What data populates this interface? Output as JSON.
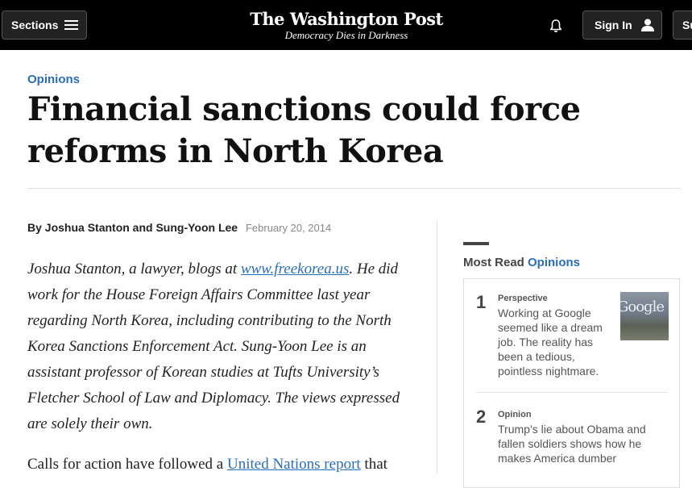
{
  "header": {
    "sections_label": "Sections",
    "logo_name": "The Washington Post",
    "logo_tagline": "Democracy Dies in Darkness",
    "signin_label": "Sign In",
    "subscribe_label": "Subscribe"
  },
  "article": {
    "kicker": "Opinions",
    "headline": "Financial sanctions could force reforms in North Korea",
    "byline": "By Joshua Stanton and Sung-Yoon Lee",
    "date": "February 20, 2014",
    "bio_before_link": "Joshua Stanton, a lawyer, blogs at ",
    "bio_link": "www.freekorea.us",
    "bio_after_link": ". He did work for the House Foreign Affairs Committee last year regarding North Korea, including contributing to the North Korea Sanctions Enforcement Act. Sung-Yoon Lee is an assistant professor of Korean studies at Tufts University’s Fletcher School of Law and Diplomacy. The views expressed are solely their own.",
    "para_before_link": "Calls for action have followed a ",
    "para_link": "United Nations report",
    "para_after_link": " that"
  },
  "most_read": {
    "title_prefix": "Most Read",
    "title_section": "Opinions",
    "items": [
      {
        "rank": "1",
        "label": "Perspective",
        "text": "Working at Google seemed like a dream job. The reality has been a tedious, pointless nightmare.",
        "thumb_text": "Google"
      },
      {
        "rank": "2",
        "label": "Opinion",
        "text": "Trump’s lie about Obama and fallen soldiers shows how he makes America dumber"
      }
    ]
  }
}
